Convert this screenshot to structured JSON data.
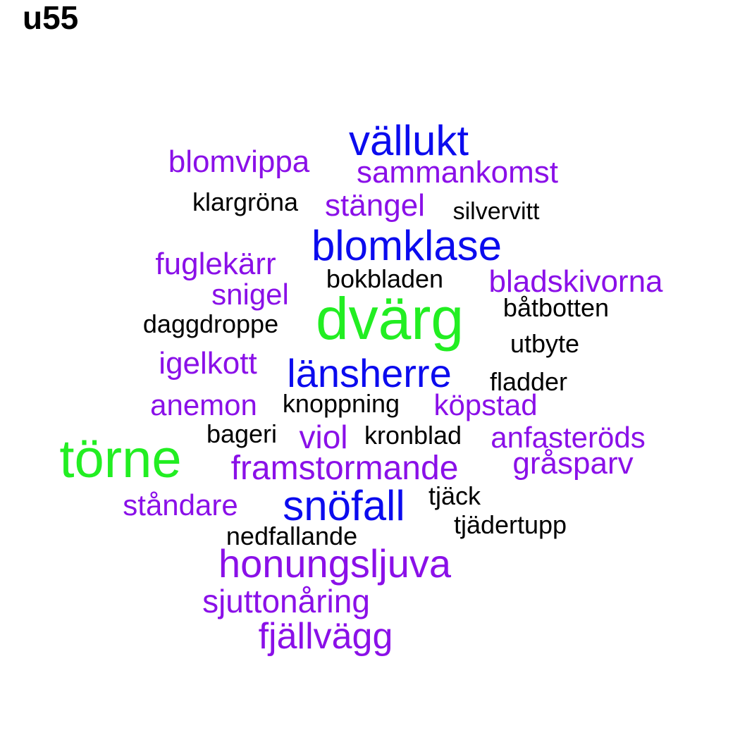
{
  "title": "u55",
  "colors": {
    "green": "#22ee22",
    "blue": "#0b0bee",
    "purple": "#8a10e8",
    "black": "#000000"
  },
  "words": [
    {
      "text": "dvärg",
      "color": "green"
    },
    {
      "text": "törne",
      "color": "green"
    },
    {
      "text": "vällukt",
      "color": "blue"
    },
    {
      "text": "blomklase",
      "color": "blue"
    },
    {
      "text": "länsherre",
      "color": "blue"
    },
    {
      "text": "snöfall",
      "color": "blue"
    },
    {
      "text": "blomvippa",
      "color": "purple"
    },
    {
      "text": "sammankomst",
      "color": "purple"
    },
    {
      "text": "stängel",
      "color": "purple"
    },
    {
      "text": "fuglekärr",
      "color": "purple"
    },
    {
      "text": "snigel",
      "color": "purple"
    },
    {
      "text": "bladskivorna",
      "color": "purple"
    },
    {
      "text": "igelkott",
      "color": "purple"
    },
    {
      "text": "anemon",
      "color": "purple"
    },
    {
      "text": "köpstad",
      "color": "purple"
    },
    {
      "text": "viol",
      "color": "purple"
    },
    {
      "text": "anfasteröds",
      "color": "purple"
    },
    {
      "text": "framstormande",
      "color": "purple"
    },
    {
      "text": "gråsparv",
      "color": "purple"
    },
    {
      "text": "ståndare",
      "color": "purple"
    },
    {
      "text": "honungsljuva",
      "color": "purple"
    },
    {
      "text": "sjuttonåring",
      "color": "purple"
    },
    {
      "text": "fjällvägg",
      "color": "purple"
    },
    {
      "text": "klargröna",
      "color": "black"
    },
    {
      "text": "silvervitt",
      "color": "black"
    },
    {
      "text": "bokbladen",
      "color": "black"
    },
    {
      "text": "båtbotten",
      "color": "black"
    },
    {
      "text": "daggdroppe",
      "color": "black"
    },
    {
      "text": "utbyte",
      "color": "black"
    },
    {
      "text": "fladder",
      "color": "black"
    },
    {
      "text": "knoppning",
      "color": "black"
    },
    {
      "text": "bageri",
      "color": "black"
    },
    {
      "text": "kronblad",
      "color": "black"
    },
    {
      "text": "tjäck",
      "color": "black"
    },
    {
      "text": "tjädertupp",
      "color": "black"
    },
    {
      "text": "nedfallande",
      "color": "black"
    }
  ]
}
